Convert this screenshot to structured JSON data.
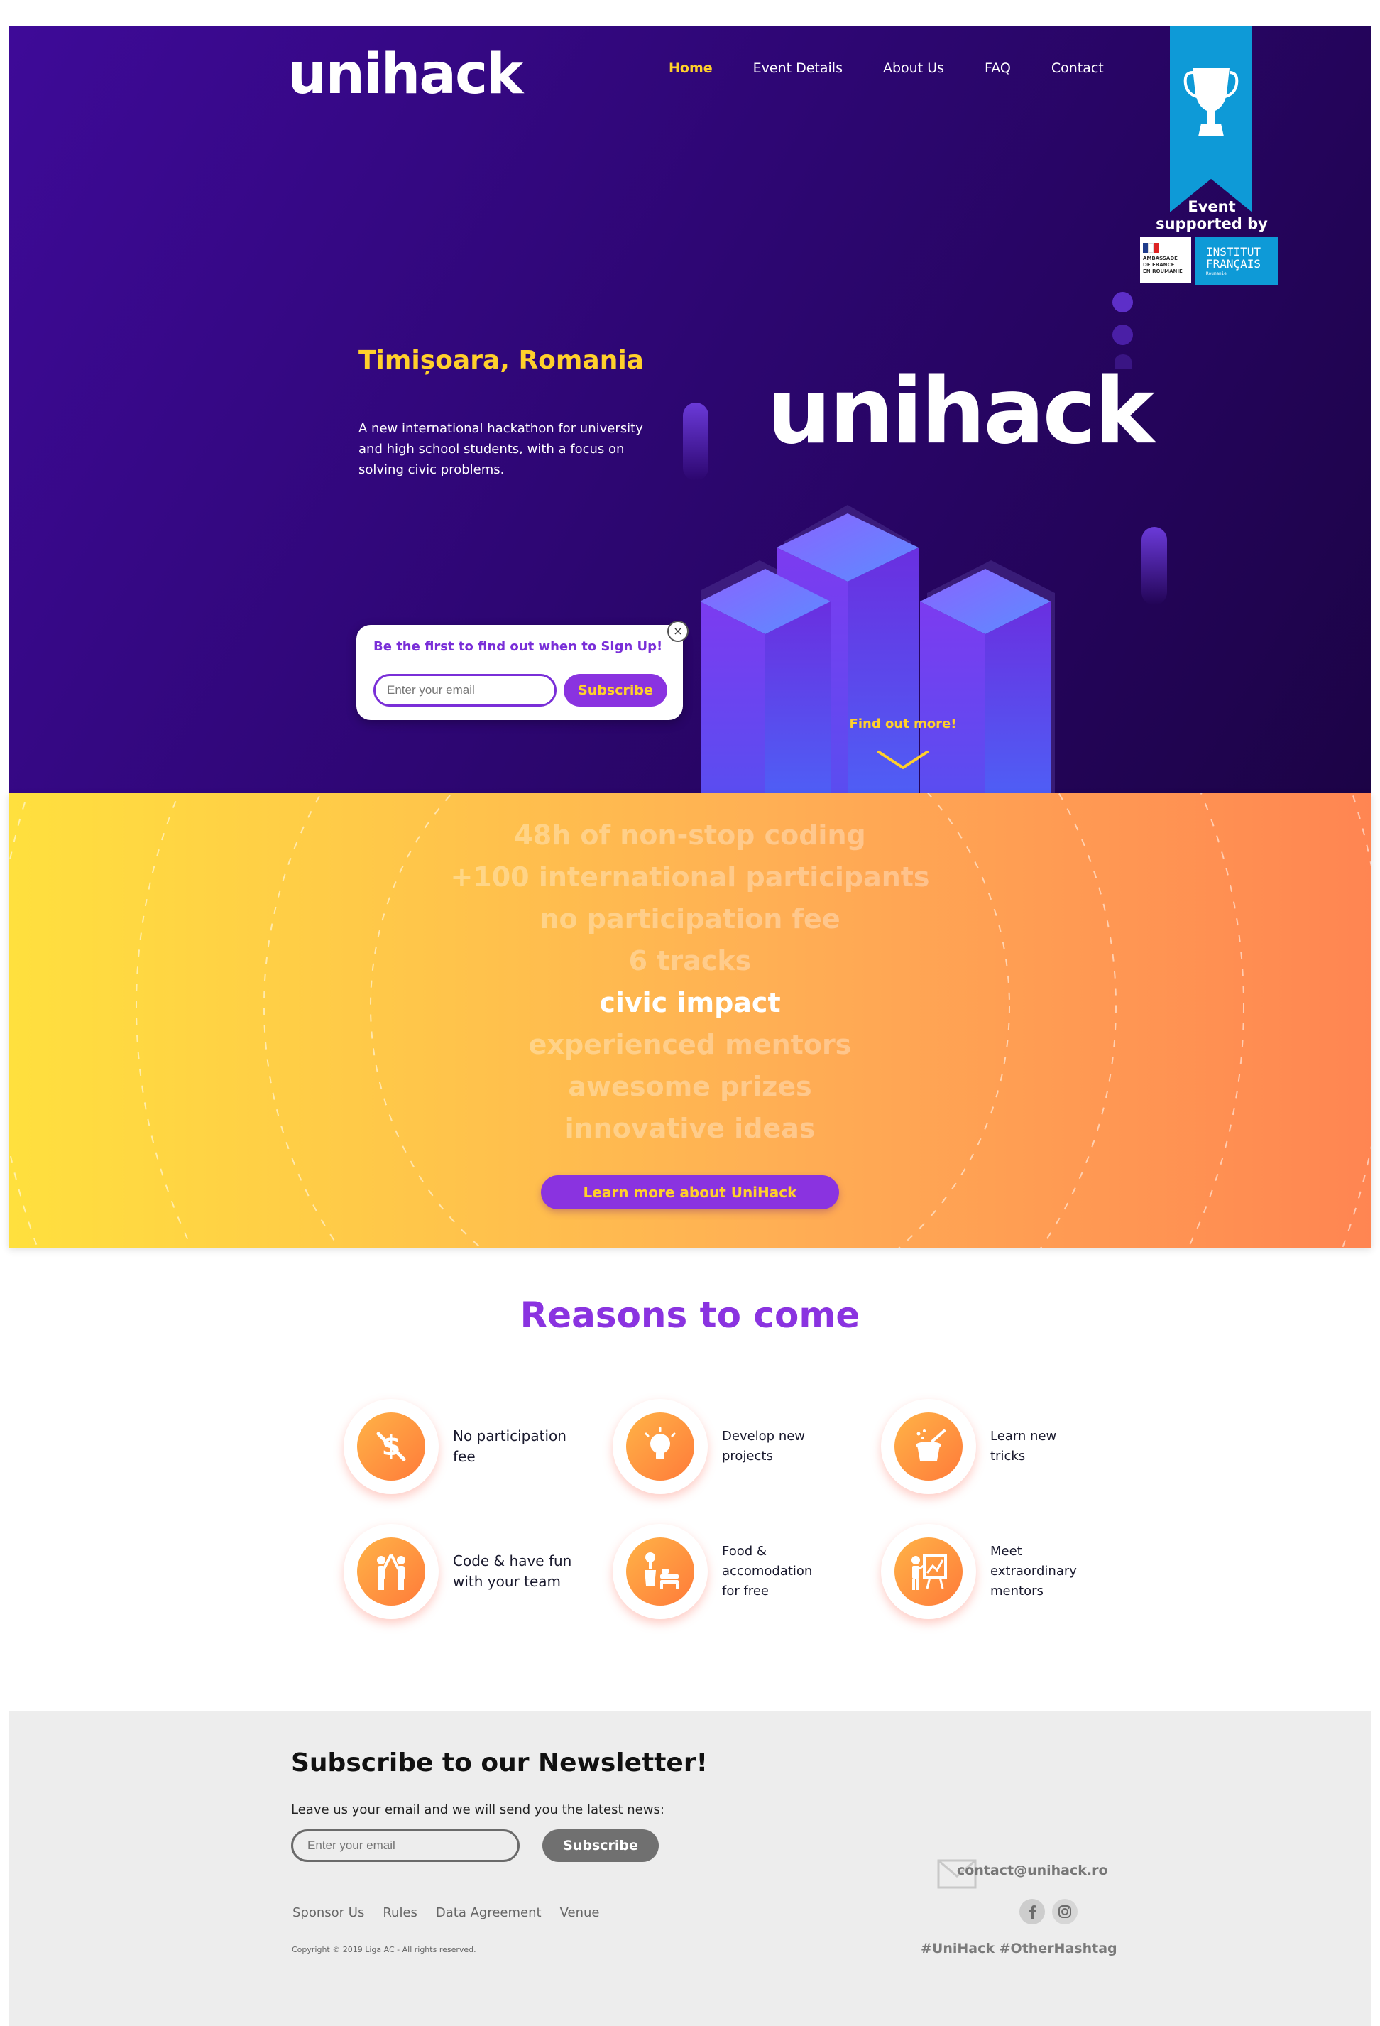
{
  "nav": {
    "logo": "unihack",
    "items": [
      {
        "label": "Home",
        "active": true
      },
      {
        "label": "Event Details"
      },
      {
        "label": "About Us"
      },
      {
        "label": "FAQ"
      },
      {
        "label": "Contact"
      }
    ]
  },
  "sponsor": {
    "ribbon_text_1": "Event",
    "ribbon_text_2": "supported by",
    "embassy_lines": [
      "AMBASSADE",
      "DE FRANCE",
      "EN ROUMANIE"
    ],
    "institut_line1": "INSTITUT",
    "institut_line2": "FRANÇAIS",
    "institut_sub": "Roumanie"
  },
  "hero": {
    "city": "Timișoara, Romania",
    "tagline": "A new international hackathon for university and high school students, with a focus on solving civic problems.",
    "logo": "unihack",
    "find_more": "Find out more!"
  },
  "signup_popup": {
    "title": "Be the first to find out when to Sign Up!",
    "placeholder": "Enter your email",
    "button": "Subscribe",
    "close": "×"
  },
  "features": {
    "items": [
      "48h of non-stop coding",
      "+100 international participants",
      "no participation fee",
      "6 tracks",
      "civic impact",
      "experienced mentors",
      "awesome prizes",
      "innovative ideas"
    ],
    "active_index": 4,
    "button": "Learn more about UniHack"
  },
  "reasons": {
    "title": "Reasons to come",
    "items": [
      {
        "label": "No participation fee",
        "icon": "no-money-icon"
      },
      {
        "label": "Develop new projects",
        "icon": "lightbulb-icon"
      },
      {
        "label": "Learn new tricks",
        "icon": "magic-hat-icon"
      },
      {
        "label": "Code & have fun with your team",
        "icon": "high-five-icon"
      },
      {
        "label": "Food & accomodation for free",
        "icon": "food-bed-icon"
      },
      {
        "label": "Meet extraordinary mentors",
        "icon": "mentor-board-icon"
      }
    ]
  },
  "newsletter": {
    "title": "Subscribe to our Newsletter!",
    "subtitle": "Leave us your email and we will send you the latest news:",
    "placeholder": "Enter your email",
    "button": "Subscribe"
  },
  "footer": {
    "links": [
      "Sponsor Us",
      "Rules",
      "Data Agreement",
      "Venue"
    ],
    "copyright": "Copyright © 2019 Liga AC - All rights reserved.",
    "email": "contact@unihack.ro",
    "hashtags": "#UniHack #OtherHashtag",
    "social": [
      "facebook-icon",
      "instagram-icon"
    ]
  },
  "colors": {
    "primary": "#8a33e0",
    "accent": "#ffd02b",
    "hero_dark": "#2d0672",
    "sponsor_blue": "#0e9ad7"
  }
}
